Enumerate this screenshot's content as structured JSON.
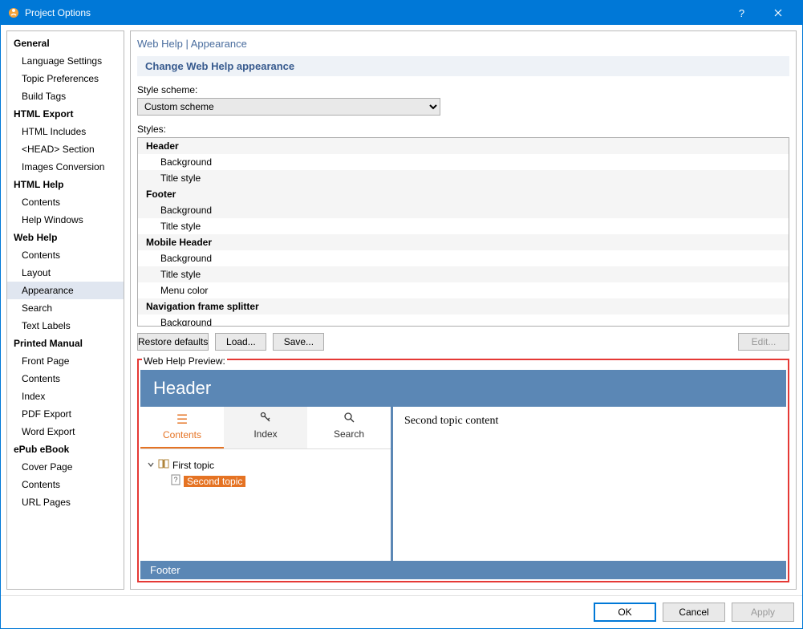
{
  "window": {
    "title": "Project Options"
  },
  "sidebar": [
    {
      "type": "cat",
      "label": "General"
    },
    {
      "type": "item",
      "label": "Language Settings"
    },
    {
      "type": "item",
      "label": "Topic Preferences"
    },
    {
      "type": "item",
      "label": "Build Tags"
    },
    {
      "type": "cat",
      "label": "HTML Export"
    },
    {
      "type": "item",
      "label": "HTML Includes"
    },
    {
      "type": "item",
      "label": "<HEAD> Section"
    },
    {
      "type": "item",
      "label": "Images Conversion"
    },
    {
      "type": "cat",
      "label": "HTML Help"
    },
    {
      "type": "item",
      "label": "Contents"
    },
    {
      "type": "item",
      "label": "Help Windows"
    },
    {
      "type": "cat",
      "label": "Web Help"
    },
    {
      "type": "item",
      "label": "Contents"
    },
    {
      "type": "item",
      "label": "Layout"
    },
    {
      "type": "item",
      "label": "Appearance",
      "selected": true
    },
    {
      "type": "item",
      "label": "Search"
    },
    {
      "type": "item",
      "label": "Text Labels"
    },
    {
      "type": "cat",
      "label": "Printed Manual"
    },
    {
      "type": "item",
      "label": "Front Page"
    },
    {
      "type": "item",
      "label": "Contents"
    },
    {
      "type": "item",
      "label": "Index"
    },
    {
      "type": "item",
      "label": "PDF Export"
    },
    {
      "type": "item",
      "label": "Word Export"
    },
    {
      "type": "cat",
      "label": "ePub eBook"
    },
    {
      "type": "item",
      "label": "Cover Page"
    },
    {
      "type": "item",
      "label": "Contents"
    },
    {
      "type": "item",
      "label": "URL Pages"
    }
  ],
  "breadcrumb": "Web Help | Appearance",
  "sectionTitle": "Change Web Help appearance",
  "labels": {
    "scheme": "Style scheme:",
    "styles": "Styles:",
    "preview": "Web Help Preview:"
  },
  "schemeValue": "Custom scheme",
  "styles": [
    {
      "type": "group",
      "label": "Header"
    },
    {
      "type": "item",
      "label": "Background"
    },
    {
      "type": "item",
      "label": "Title style"
    },
    {
      "type": "group",
      "label": "Footer"
    },
    {
      "type": "item",
      "label": "Background"
    },
    {
      "type": "item",
      "label": "Title style"
    },
    {
      "type": "group",
      "label": "Mobile Header"
    },
    {
      "type": "item",
      "label": "Background"
    },
    {
      "type": "item",
      "label": "Title style"
    },
    {
      "type": "item",
      "label": "Menu color"
    },
    {
      "type": "group",
      "label": "Navigation frame splitter"
    },
    {
      "type": "item",
      "label": "Background"
    }
  ],
  "buttons": {
    "restore": "Restore defaults",
    "load": "Load...",
    "save": "Save...",
    "edit": "Edit..."
  },
  "preview": {
    "header": "Header",
    "tabs": {
      "contents": "Contents",
      "index": "Index",
      "search": "Search"
    },
    "tree": {
      "first": "First topic",
      "second": "Second topic"
    },
    "content": "Second topic content",
    "footer": "Footer"
  },
  "dialog": {
    "ok": "OK",
    "cancel": "Cancel",
    "apply": "Apply"
  }
}
